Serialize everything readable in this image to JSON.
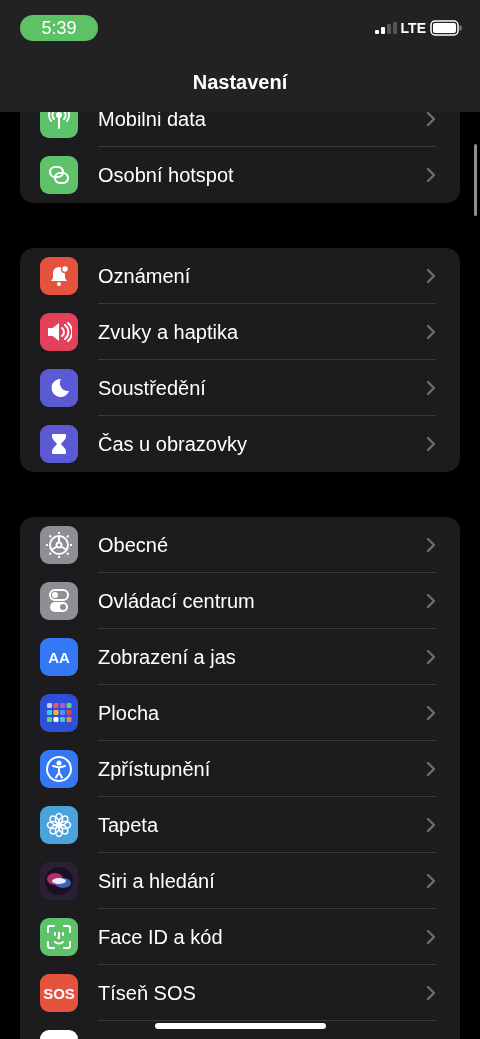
{
  "status_bar": {
    "time": "5:39",
    "network": "LTE"
  },
  "title": "Nastavení",
  "groups": [
    {
      "items": [
        {
          "label": "Mobilni data",
          "kind": "antenna",
          "color": "#5ec26a"
        },
        {
          "label": "Osobní hotspot",
          "kind": "link",
          "color": "#5ec26a"
        }
      ]
    },
    {
      "items": [
        {
          "label": "Oznámení",
          "kind": "bell",
          "color": "#e5533f"
        },
        {
          "label": "Zvuky a haptika",
          "kind": "speaker",
          "color": "#e3405a"
        },
        {
          "label": "Soustředění",
          "kind": "moon",
          "color": "#5b59d4"
        },
        {
          "label": "Čas u obrazovky",
          "kind": "hourglass",
          "color": "#5b59d4"
        }
      ]
    },
    {
      "items": [
        {
          "label": "Obecné",
          "kind": "gear",
          "color": "#8e8e93"
        },
        {
          "label": "Ovládací centrum",
          "kind": "toggles",
          "color": "#8e8e93"
        },
        {
          "label": "Zobrazení a jas",
          "kind": "letters",
          "icon_text": "AA",
          "color": "#3478f6"
        },
        {
          "label": "Plocha",
          "kind": "grid",
          "color": "#2e4fd8"
        },
        {
          "label": "Zpřístupnění",
          "kind": "person",
          "color": "#3478f6"
        },
        {
          "label": "Tapeta",
          "kind": "flower",
          "color": "#4ba3dc"
        },
        {
          "label": "Siri a hledání",
          "kind": "orb",
          "color": "#2a1f33"
        },
        {
          "label": "Face ID a kód",
          "kind": "face",
          "color": "#5ec26a"
        },
        {
          "label": "Tíseň SOS",
          "kind": "letters",
          "icon_text": "SOS",
          "color": "#e5533f"
        },
        {
          "color": "#ffffff"
        }
      ]
    }
  ]
}
